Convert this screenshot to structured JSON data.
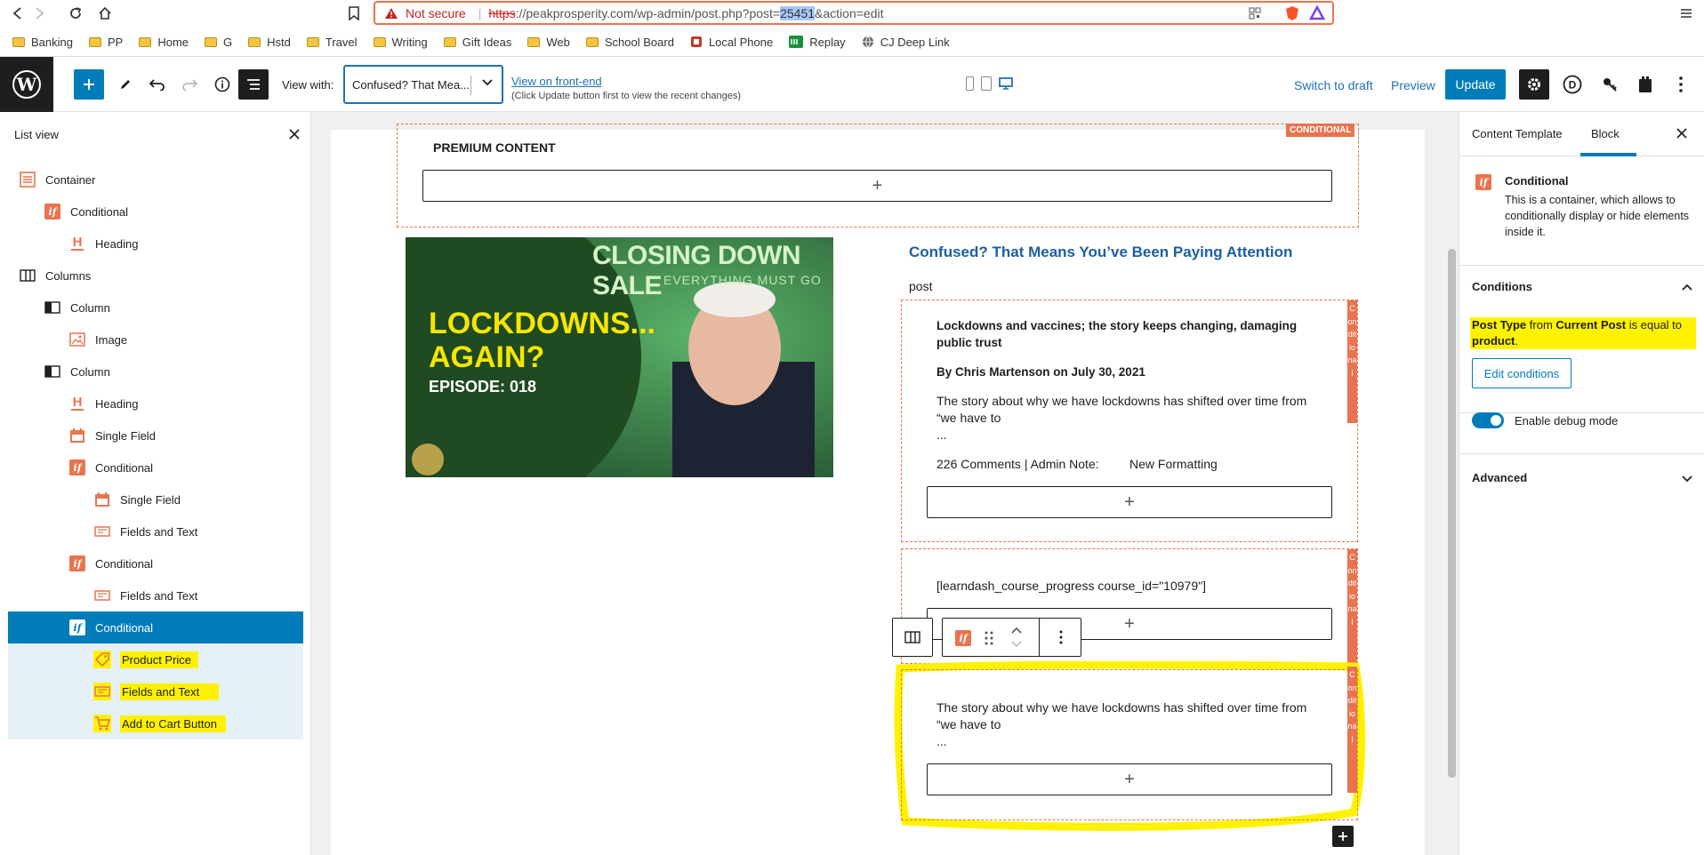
{
  "browser": {
    "not_secure": "Not secure",
    "url_scheme": "https",
    "url_main": "://peakprosperity.com/wp-admin/post.php?post=",
    "url_highlight": "25451",
    "url_tail": "&action=edit",
    "bookmarks": [
      {
        "label": "Banking",
        "icon": "folder-icon"
      },
      {
        "label": "PP",
        "icon": "folder-icon"
      },
      {
        "label": "Home",
        "icon": "folder-icon"
      },
      {
        "label": "G",
        "icon": "folder-icon"
      },
      {
        "label": "Hstd",
        "icon": "folder-icon"
      },
      {
        "label": "Travel",
        "icon": "folder-icon"
      },
      {
        "label": "Writing",
        "icon": "folder-icon"
      },
      {
        "label": "Gift Ideas",
        "icon": "folder-icon"
      },
      {
        "label": "Web",
        "icon": "folder-icon"
      },
      {
        "label": "School Board",
        "icon": "folder-icon"
      },
      {
        "label": "Local Phone",
        "icon": "phone-icon"
      },
      {
        "label": "Replay",
        "icon": "replay-icon"
      },
      {
        "label": "CJ Deep Link",
        "icon": "globe-icon"
      }
    ]
  },
  "toolbar": {
    "view_with_label": "View with:",
    "view_with_value": "Confused? That Mea...",
    "view_front_end": "View on front-end",
    "view_note": "(Click Update button first to view the recent changes)",
    "switch_to_draft": "Switch to draft",
    "preview": "Preview",
    "update": "Update",
    "accent": "#007cba"
  },
  "list_view": {
    "title": "List view",
    "items": [
      {
        "label": "Container",
        "icon": "container-icon"
      },
      {
        "label": "Conditional",
        "icon": "conditional-icon"
      },
      {
        "label": "Heading",
        "icon": "heading-icon"
      },
      {
        "label": "Columns",
        "icon": "columns-icon"
      },
      {
        "label": "Column",
        "icon": "column-icon"
      },
      {
        "label": "Image",
        "icon": "image-icon"
      },
      {
        "label": "Column",
        "icon": "column-icon"
      },
      {
        "label": "Heading",
        "icon": "heading-icon"
      },
      {
        "label": "Single Field",
        "icon": "single-field-icon"
      },
      {
        "label": "Conditional",
        "icon": "conditional-icon"
      },
      {
        "label": "Single Field",
        "icon": "single-field-icon"
      },
      {
        "label": "Fields and Text",
        "icon": "fields-text-icon"
      },
      {
        "label": "Conditional",
        "icon": "conditional-icon"
      },
      {
        "label": "Fields and Text",
        "icon": "fields-text-icon"
      },
      {
        "label": "Conditional",
        "icon": "conditional-icon"
      },
      {
        "label": "Product Price",
        "icon": "price-tag-icon"
      },
      {
        "label": "Fields and Text",
        "icon": "fields-text-icon"
      },
      {
        "label": "Add to Cart Button",
        "icon": "cart-icon"
      }
    ]
  },
  "canvas": {
    "premium_content": "PREMIUM CONTENT",
    "conditional_tag": "CONDITIONAL",
    "vertical_tag": "Conditional",
    "image": {
      "banner": "CLOSING DOWN SALE",
      "banner_sub": "EVERYTHING MUST GO",
      "headline": "LOCKDOWNS...",
      "headline2": "AGAIN?",
      "episode": "EPISODE: 018"
    },
    "post_title": "Confused? That Means You’ve Been Paying Attention",
    "post_label": "post",
    "block1": {
      "title": "Lockdowns and vaccines; the story keeps changing, damaging public trust",
      "byline": "By Chris Martenson on July 30, 2021",
      "excerpt_line1": "The story about why we have lockdowns has shifted over time from",
      "excerpt_line2": "“we have to",
      "ellipsis": "...",
      "comments": "226 Comments | Admin Note:",
      "admin_note": "New Formatting"
    },
    "block2": {
      "shortcode": "[learndash_course_progress course_id=\"10979\"]"
    },
    "block3": {
      "excerpt_line1": "The story about why we have lockdowns has shifted over time from",
      "excerpt_line2": "“we have to",
      "ellipsis": "..."
    },
    "highlight_color": "#fff200",
    "orange": "#e8744f"
  },
  "sidebar": {
    "tabs": [
      "Content Template",
      "Block"
    ],
    "block_name": "Conditional",
    "block_desc": "This is a container, which allows to conditionally display or hide elements inside it.",
    "conditions_title": "Conditions",
    "condition_parts": [
      "Post Type",
      " from ",
      "Current Post",
      " is equal to ",
      "product",
      "."
    ],
    "edit_conditions": "Edit conditions",
    "debug_mode": "Enable debug mode",
    "debug_enabled": true,
    "advanced": "Advanced"
  }
}
